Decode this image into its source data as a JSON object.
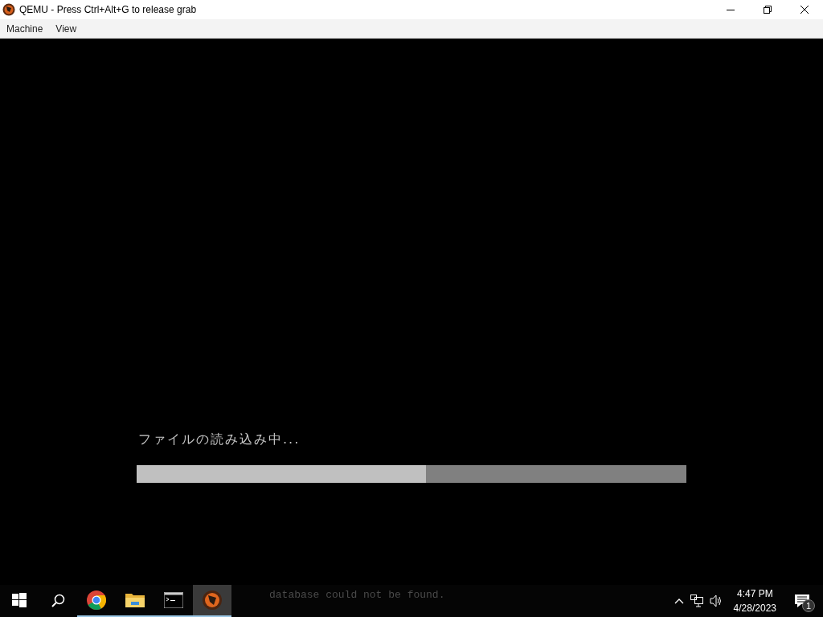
{
  "window": {
    "title": "QEMU - Press Ctrl+Alt+G to release grab"
  },
  "menu": [
    {
      "label": "Machine"
    },
    {
      "label": "View"
    }
  ],
  "screen": {
    "message": "ファイルの読み込み中...",
    "progress": {
      "level": 0.526
    }
  },
  "console_fragment": "database could not be found.",
  "taskbar": {
    "apps": [
      {
        "kind": "browser",
        "running": true,
        "active": false
      },
      {
        "kind": "folder",
        "running": true,
        "active": false
      },
      {
        "kind": "terminal",
        "running": true,
        "active": false
      },
      {
        "kind": "qemu",
        "running": true,
        "active": true
      }
    ],
    "clock": {
      "time": "4:47 PM",
      "date": "4/28/2023"
    },
    "notifications": "1"
  }
}
